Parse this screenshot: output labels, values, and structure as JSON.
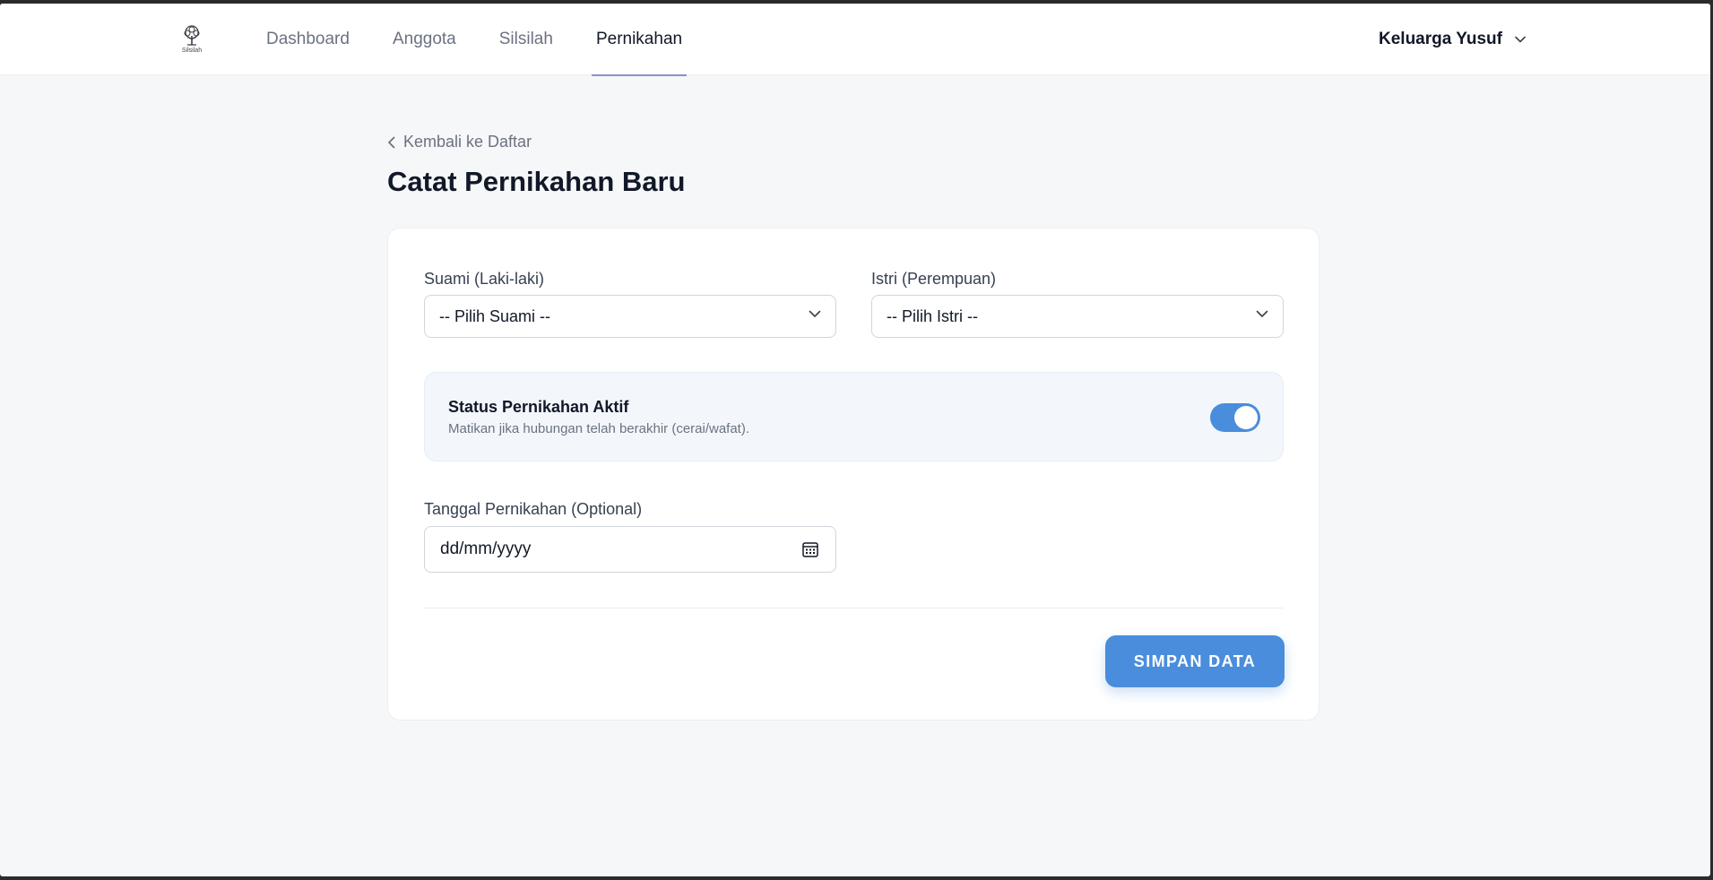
{
  "app": {
    "logo_text": "Silsilah"
  },
  "nav": {
    "items": [
      {
        "label": "Dashboard",
        "active": false
      },
      {
        "label": "Anggota",
        "active": false
      },
      {
        "label": "Silsilah",
        "active": false
      },
      {
        "label": "Pernikahan",
        "active": true
      }
    ],
    "family_selector": "Keluarga Yusuf"
  },
  "page": {
    "back_label": "Kembali ke Daftar",
    "title": "Catat Pernikahan Baru"
  },
  "form": {
    "husband": {
      "label": "Suami (Laki-laki)",
      "value": "-- Pilih Suami --"
    },
    "wife": {
      "label": "Istri (Perempuan)",
      "value": "-- Pilih Istri --"
    },
    "status": {
      "title": "Status Pernikahan Aktif",
      "description": "Matikan jika hubungan telah berakhir (cerai/wafat).",
      "enabled": true
    },
    "date": {
      "label": "Tanggal Pernikahan (Optional)",
      "placeholder": "dd/mm/yyyy"
    },
    "submit_label": "SIMPAN DATA"
  },
  "colors": {
    "accent": "#4a8ddc",
    "nav_active_underline": "#8b8fd8",
    "background": "#f6f7f9"
  },
  "icons": [
    "tree-logo-icon",
    "chevron-down-icon",
    "chevron-left-icon",
    "calendar-icon"
  ]
}
